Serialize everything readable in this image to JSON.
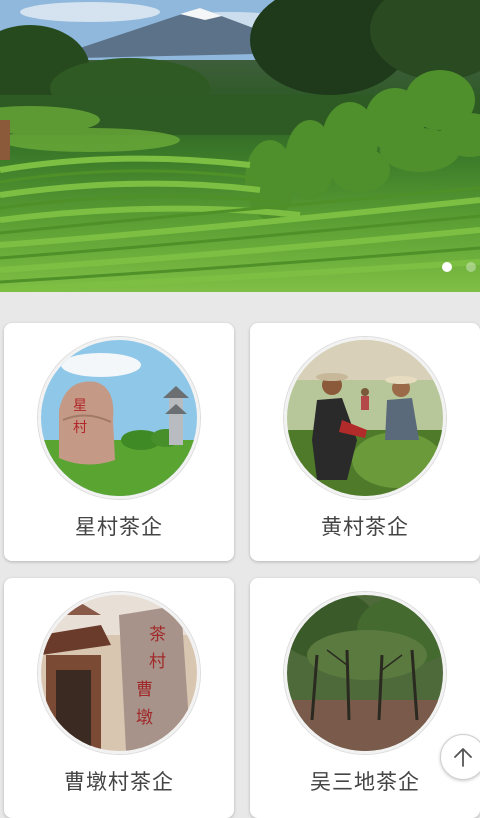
{
  "banner": {
    "image": "tea-plantation-with-mountain",
    "dots": [
      {
        "active": true
      },
      {
        "active": false
      }
    ]
  },
  "companies": [
    {
      "name": "星村茶企",
      "image": "rock-and-pavilion"
    },
    {
      "name": "黄村茶企",
      "image": "tea-pickers"
    },
    {
      "name": "曹墩村茶企",
      "image": "old-gate-stone"
    },
    {
      "name": "吴三地茶企",
      "image": "tea-forest"
    }
  ],
  "scroll_top": {
    "icon": "arrow-up-icon"
  }
}
